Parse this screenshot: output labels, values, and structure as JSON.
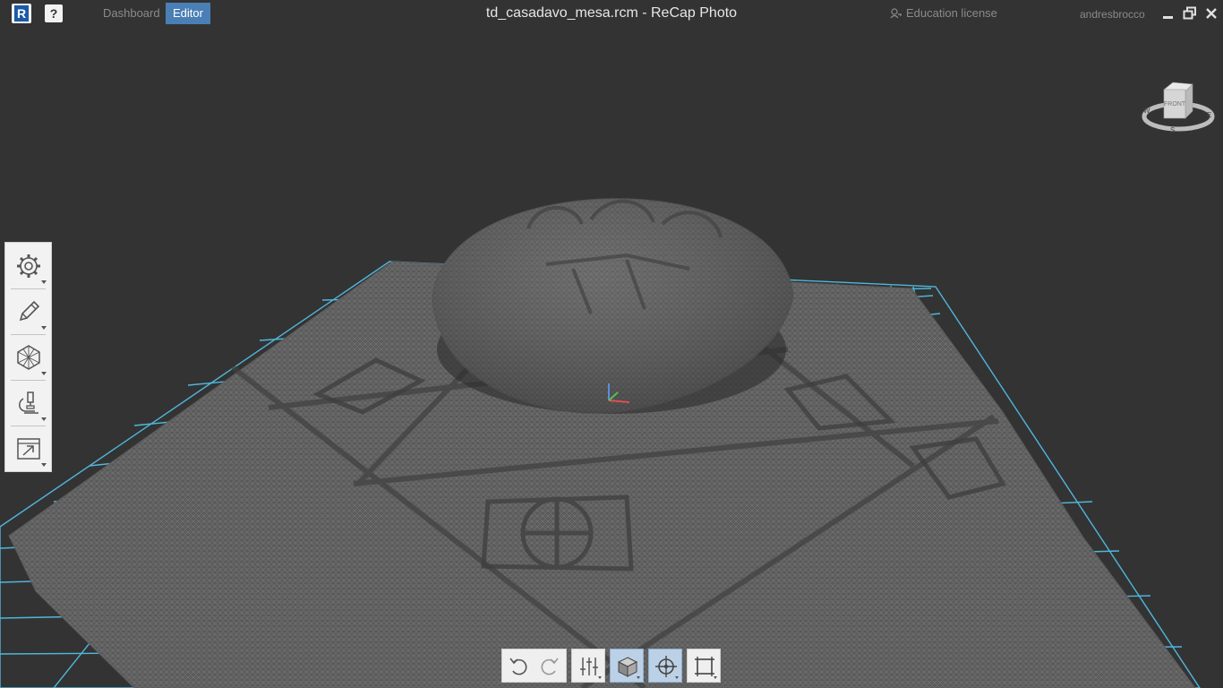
{
  "topbar": {
    "logo_letter": "R",
    "help_label": "?",
    "tabs": [
      {
        "label": "Dashboard",
        "active": false
      },
      {
        "label": "Editor",
        "active": true
      }
    ],
    "title": "td_casadavo_mesa.rcm - ReCap Photo",
    "license": "Education license",
    "username": "andresbrocco"
  },
  "viewcube": {
    "face": "FRONT",
    "compass": {
      "west": "W",
      "south": "S",
      "east": "E"
    }
  },
  "left_toolbar": [
    {
      "name": "settings",
      "icon": "gear-icon"
    },
    {
      "name": "edit",
      "icon": "pencil-icon"
    },
    {
      "name": "mesh",
      "icon": "hexagon-mesh-icon"
    },
    {
      "name": "analyze",
      "icon": "microscope-icon"
    },
    {
      "name": "export",
      "icon": "export-icon"
    }
  ],
  "bottom_toolbar": [
    {
      "name": "undo",
      "icon": "undo-icon",
      "active": false
    },
    {
      "name": "redo",
      "icon": "redo-icon",
      "active": false
    },
    {
      "name": "adjust",
      "icon": "sliders-icon",
      "active": false
    },
    {
      "name": "render-mode",
      "icon": "cube-icon",
      "active": true
    },
    {
      "name": "pivot",
      "icon": "crosshair-icon",
      "active": true
    },
    {
      "name": "fit-view",
      "icon": "fit-frame-icon",
      "active": false
    }
  ],
  "colors": {
    "background": "#333333",
    "grid": "#4fb7dc",
    "accent": "#4a7fb5",
    "mesh": "#6b6b6b"
  }
}
